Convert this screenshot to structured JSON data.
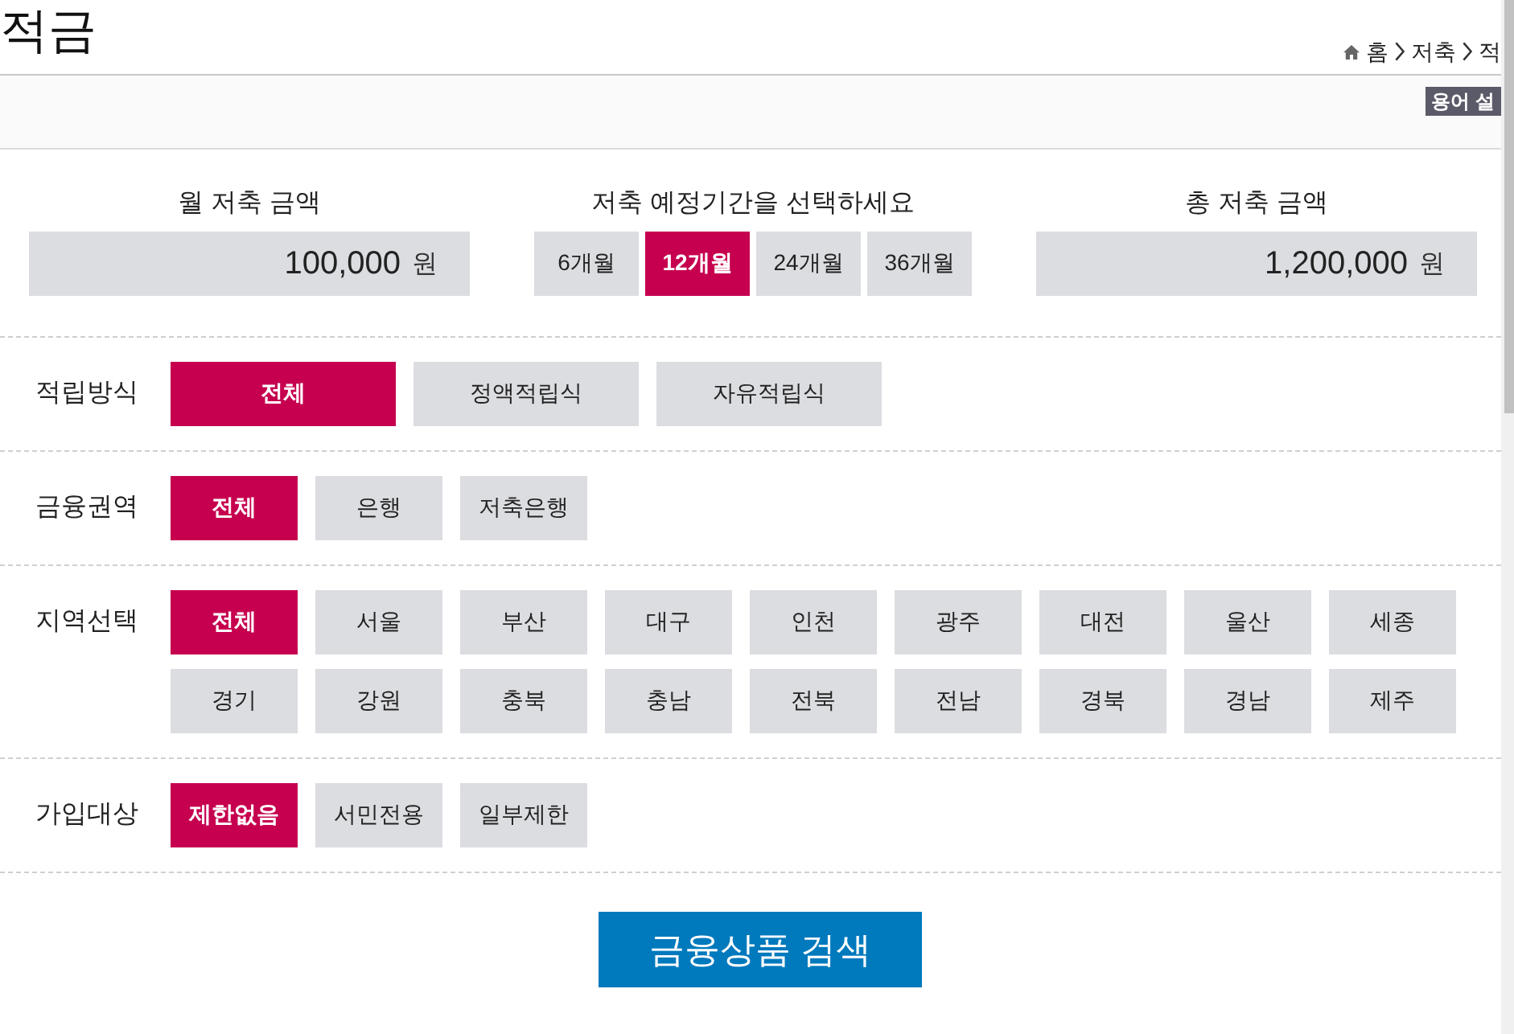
{
  "page": {
    "title": "적금"
  },
  "breadcrumb": [
    {
      "label": "홈"
    },
    {
      "label": "저축"
    },
    {
      "label": "적"
    }
  ],
  "toolbar": {
    "glossary_button": "용어 설"
  },
  "calculator": {
    "monthly": {
      "label": "월 저축 금액",
      "value": "100,000",
      "unit": "원"
    },
    "period": {
      "label": "저축 예정기간을 선택하세요",
      "options": [
        {
          "label": "6개월",
          "selected": false
        },
        {
          "label": "12개월",
          "selected": true
        },
        {
          "label": "24개월",
          "selected": false
        },
        {
          "label": "36개월",
          "selected": false
        }
      ]
    },
    "total": {
      "label": "총 저축 금액",
      "value": "1,200,000",
      "unit": "원"
    }
  },
  "filters": [
    {
      "label": "적립방식",
      "kind": "wide",
      "options": [
        {
          "label": "전체",
          "selected": true
        },
        {
          "label": "정액적립식",
          "selected": false
        },
        {
          "label": "자유적립식",
          "selected": false
        }
      ]
    },
    {
      "label": "금융권역",
      "kind": "compact",
      "options": [
        {
          "label": "전체",
          "selected": true
        },
        {
          "label": "은행",
          "selected": false
        },
        {
          "label": "저축은행",
          "selected": false
        }
      ]
    },
    {
      "label": "지역선택",
      "kind": "compact",
      "options": [
        {
          "label": "전체",
          "selected": true
        },
        {
          "label": "서울",
          "selected": false
        },
        {
          "label": "부산",
          "selected": false
        },
        {
          "label": "대구",
          "selected": false
        },
        {
          "label": "인천",
          "selected": false
        },
        {
          "label": "광주",
          "selected": false
        },
        {
          "label": "대전",
          "selected": false
        },
        {
          "label": "울산",
          "selected": false
        },
        {
          "label": "세종",
          "selected": false
        },
        {
          "label": "경기",
          "selected": false
        },
        {
          "label": "강원",
          "selected": false
        },
        {
          "label": "충북",
          "selected": false
        },
        {
          "label": "충남",
          "selected": false
        },
        {
          "label": "전북",
          "selected": false
        },
        {
          "label": "전남",
          "selected": false
        },
        {
          "label": "경북",
          "selected": false
        },
        {
          "label": "경남",
          "selected": false
        },
        {
          "label": "제주",
          "selected": false
        }
      ]
    },
    {
      "label": "가입대상",
      "kind": "compact",
      "options": [
        {
          "label": "제한없음",
          "selected": true
        },
        {
          "label": "서민전용",
          "selected": false
        },
        {
          "label": "일부제한",
          "selected": false
        }
      ]
    }
  ],
  "search_button": "금융상품 검색"
}
